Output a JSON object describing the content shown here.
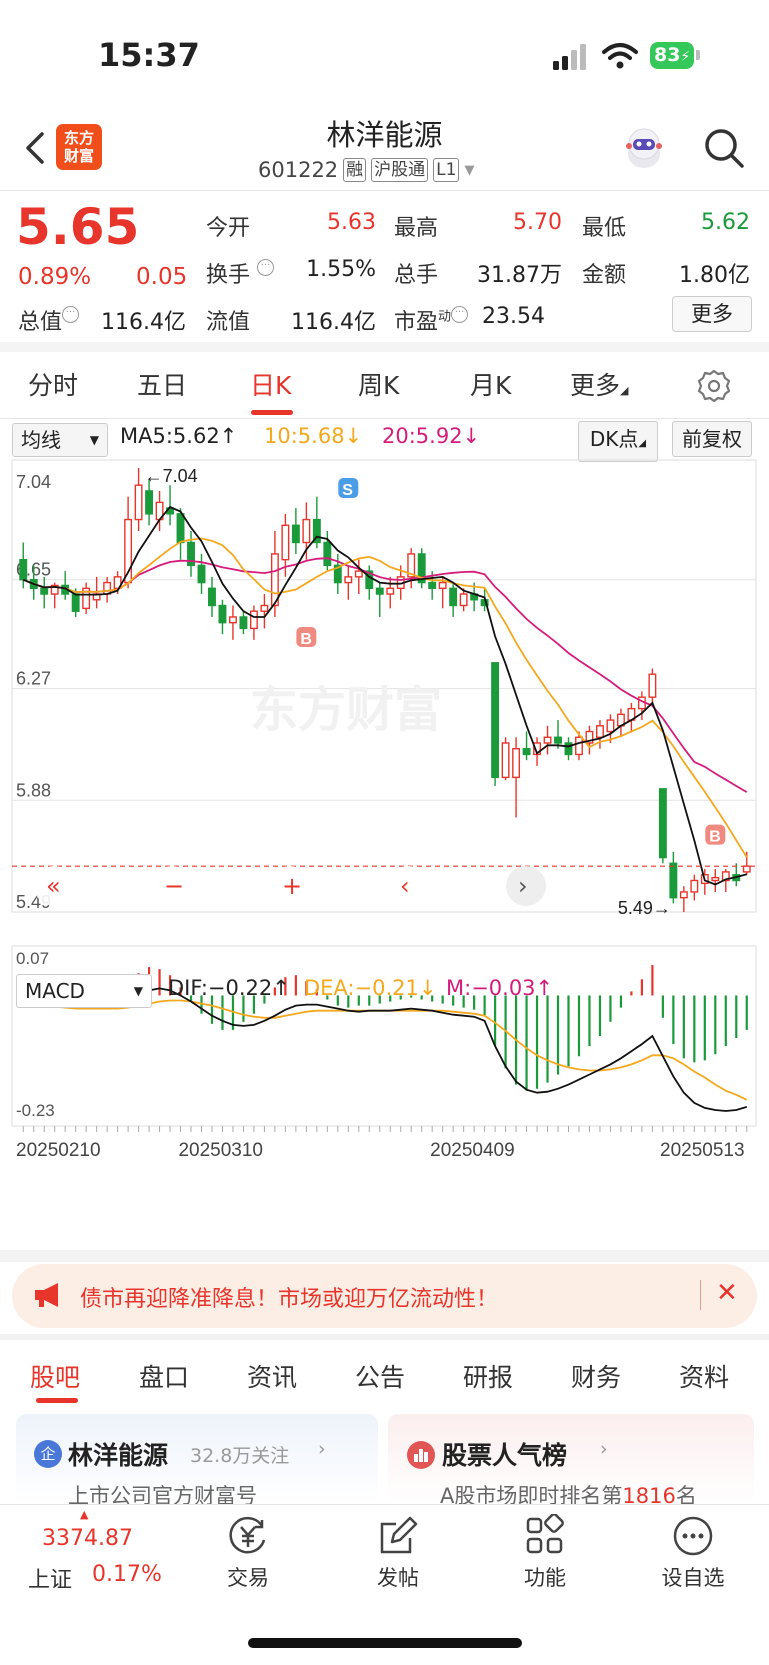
{
  "status": {
    "time": "15:37",
    "battery": "83"
  },
  "header": {
    "logo_line1": "东方",
    "logo_line2": "财富",
    "title": "林洋能源",
    "code": "601222",
    "tag_margin": "融",
    "tag_connect": "沪股通",
    "tag_level": "L1"
  },
  "quote": {
    "price": "5.65",
    "change_pct": "0.89%",
    "change": "0.05",
    "open_label": "今开",
    "open": "5.63",
    "high_label": "最高",
    "high": "5.70",
    "low_label": "最低",
    "low": "5.62",
    "turnover_label": "换手",
    "turnover": "1.55%",
    "volume_label": "总手",
    "volume": "31.87万",
    "amount_label": "金额",
    "amount": "1.80亿",
    "mktcap_label": "总值",
    "mktcap": "116.4亿",
    "float_label": "流值",
    "float_cap": "116.4亿",
    "pe_label": "市盈",
    "pe_sup": "动",
    "pe": "23.54",
    "more_button": "更多"
  },
  "period_tabs": [
    "分时",
    "五日",
    "日K",
    "周K",
    "月K",
    "更多"
  ],
  "ma_row": {
    "indicator_select": "均线",
    "ma5": "MA5:5.62↑",
    "ma10": "10:5.68↓",
    "ma20": "20:5.92↓",
    "dk_button": "DK点",
    "adjust_button": "前复权"
  },
  "macd_row": {
    "indicator_select": "MACD",
    "dif": "DIF:−0.22↑",
    "dea": "DEA:−0.21↓",
    "m": "M:−0.03↑"
  },
  "colors": {
    "up": "#e8352b",
    "down": "#1a9a3a",
    "ma5": "#111111",
    "ma10": "#f4a81d",
    "ma20": "#d61c7b"
  },
  "chart_data": {
    "type": "candlestick",
    "price_axis_ticks": [
      "7.04",
      "6.65",
      "6.27",
      "5.88",
      "5.49"
    ],
    "ylim": [
      5.49,
      7.04
    ],
    "macd_axis_ticks": [
      "0.07",
      "-0.23"
    ],
    "macd_ylim": [
      -0.23,
      0.07
    ],
    "date_labels": [
      "20250210",
      "20250310",
      "20250409",
      "20250513"
    ],
    "annotations": {
      "max_label": "←7.04",
      "min_label": "5.49→",
      "watermark": "东方财富",
      "signal_S": "S",
      "signal_B": "B"
    },
    "candles": [
      [
        6.72,
        6.78,
        6.62,
        6.65
      ],
      [
        6.65,
        6.7,
        6.58,
        6.62
      ],
      [
        6.62,
        6.66,
        6.55,
        6.6
      ],
      [
        6.6,
        6.64,
        6.55,
        6.63
      ],
      [
        6.63,
        6.68,
        6.58,
        6.6
      ],
      [
        6.6,
        6.62,
        6.52,
        6.54
      ],
      [
        6.55,
        6.64,
        6.53,
        6.62
      ],
      [
        6.58,
        6.66,
        6.55,
        6.6
      ],
      [
        6.6,
        6.66,
        6.57,
        6.64
      ],
      [
        6.62,
        6.68,
        6.6,
        6.66
      ],
      [
        6.64,
        6.94,
        6.62,
        6.86
      ],
      [
        6.86,
        7.04,
        6.82,
        6.98
      ],
      [
        6.96,
        7.0,
        6.84,
        6.88
      ],
      [
        6.86,
        6.96,
        6.82,
        6.92
      ],
      [
        6.9,
        6.98,
        6.84,
        6.88
      ],
      [
        6.88,
        6.9,
        6.72,
        6.78
      ],
      [
        6.78,
        6.82,
        6.66,
        6.7
      ],
      [
        6.7,
        6.74,
        6.6,
        6.64
      ],
      [
        6.62,
        6.66,
        6.52,
        6.56
      ],
      [
        6.56,
        6.58,
        6.46,
        6.5
      ],
      [
        6.5,
        6.56,
        6.44,
        6.52
      ],
      [
        6.52,
        6.54,
        6.46,
        6.48
      ],
      [
        6.48,
        6.56,
        6.44,
        6.54
      ],
      [
        6.54,
        6.6,
        6.48,
        6.56
      ],
      [
        6.56,
        6.82,
        6.52,
        6.74
      ],
      [
        6.72,
        6.88,
        6.66,
        6.84
      ],
      [
        6.84,
        6.9,
        6.74,
        6.78
      ],
      [
        6.78,
        6.92,
        6.72,
        6.86
      ],
      [
        6.86,
        6.94,
        6.76,
        6.78
      ],
      [
        6.78,
        6.82,
        6.68,
        6.7
      ],
      [
        6.7,
        6.74,
        6.6,
        6.64
      ],
      [
        6.64,
        6.7,
        6.58,
        6.66
      ],
      [
        6.66,
        6.72,
        6.6,
        6.68
      ],
      [
        6.68,
        6.7,
        6.58,
        6.62
      ],
      [
        6.62,
        6.64,
        6.52,
        6.6
      ],
      [
        6.6,
        6.66,
        6.55,
        6.62
      ],
      [
        6.62,
        6.7,
        6.58,
        6.66
      ],
      [
        6.66,
        6.76,
        6.62,
        6.74
      ],
      [
        6.74,
        6.76,
        6.62,
        6.64
      ],
      [
        6.64,
        6.68,
        6.58,
        6.62
      ],
      [
        6.62,
        6.66,
        6.55,
        6.64
      ],
      [
        6.62,
        6.64,
        6.52,
        6.56
      ],
      [
        6.56,
        6.62,
        6.54,
        6.6
      ],
      [
        6.6,
        6.64,
        6.54,
        6.58
      ],
      [
        6.58,
        6.62,
        6.54,
        6.56
      ],
      [
        6.36,
        6.36,
        5.93,
        5.96
      ],
      [
        5.96,
        6.1,
        5.95,
        6.08
      ],
      [
        5.96,
        6.1,
        5.82,
        6.06
      ],
      [
        6.06,
        6.12,
        6.02,
        6.04
      ],
      [
        6.04,
        6.1,
        6.0,
        6.08
      ],
      [
        6.08,
        6.14,
        6.04,
        6.1
      ],
      [
        6.1,
        6.16,
        6.06,
        6.08
      ],
      [
        6.08,
        6.1,
        6.02,
        6.04
      ],
      [
        6.04,
        6.12,
        6.02,
        6.1
      ],
      [
        6.08,
        6.14,
        6.04,
        6.12
      ],
      [
        6.1,
        6.16,
        6.06,
        6.14
      ],
      [
        6.12,
        6.18,
        6.08,
        6.16
      ],
      [
        6.14,
        6.2,
        6.1,
        6.18
      ],
      [
        6.16,
        6.22,
        6.12,
        6.2
      ],
      [
        6.2,
        6.26,
        6.16,
        6.24
      ],
      [
        6.24,
        6.34,
        6.22,
        6.32
      ],
      [
        5.92,
        5.92,
        5.66,
        5.68
      ],
      [
        5.66,
        5.7,
        5.52,
        5.54
      ],
      [
        5.54,
        5.58,
        5.49,
        5.56
      ],
      [
        5.56,
        5.62,
        5.53,
        5.6
      ],
      [
        5.59,
        5.64,
        5.55,
        5.62
      ],
      [
        5.6,
        5.64,
        5.56,
        5.61
      ],
      [
        5.6,
        5.64,
        5.56,
        5.63
      ],
      [
        5.62,
        5.66,
        5.58,
        5.6
      ],
      [
        5.63,
        5.7,
        5.62,
        5.65
      ]
    ],
    "macd_hist": [
      0.018,
      0.012,
      0.008,
      0.004,
      -0.004,
      -0.01,
      -0.006,
      -0.002,
      0.002,
      0.006,
      0.014,
      0.022,
      0.028,
      0.026,
      0.02,
      0.008,
      -0.006,
      -0.018,
      -0.028,
      -0.034,
      -0.034,
      -0.026,
      -0.018,
      -0.008,
      0.008,
      0.018,
      0.02,
      0.014,
      0.006,
      -0.004,
      -0.01,
      -0.012,
      -0.01,
      -0.01,
      -0.008,
      -0.006,
      -0.004,
      -0.002,
      -0.004,
      -0.006,
      -0.008,
      -0.01,
      -0.012,
      -0.014,
      -0.02,
      -0.05,
      -0.072,
      -0.088,
      -0.094,
      -0.092,
      -0.086,
      -0.078,
      -0.07,
      -0.06,
      -0.05,
      -0.04,
      -0.026,
      -0.012,
      0.004,
      0.016,
      0.03,
      -0.022,
      -0.048,
      -0.062,
      -0.066,
      -0.064,
      -0.058,
      -0.05,
      -0.042,
      -0.034
    ],
    "dif_line": [
      0.0,
      -0.002,
      -0.006,
      -0.01,
      -0.016,
      -0.02,
      -0.022,
      -0.022,
      -0.022,
      -0.02,
      -0.01,
      0.002,
      0.01,
      0.014,
      0.01,
      0.0,
      -0.012,
      -0.026,
      -0.04,
      -0.05,
      -0.058,
      -0.06,
      -0.058,
      -0.05,
      -0.04,
      -0.028,
      -0.02,
      -0.018,
      -0.018,
      -0.022,
      -0.026,
      -0.03,
      -0.032,
      -0.03,
      -0.03,
      -0.03,
      -0.028,
      -0.026,
      -0.028,
      -0.03,
      -0.034,
      -0.038,
      -0.04,
      -0.042,
      -0.05,
      -0.1,
      -0.14,
      -0.17,
      -0.186,
      -0.192,
      -0.19,
      -0.184,
      -0.176,
      -0.166,
      -0.156,
      -0.146,
      -0.136,
      -0.124,
      -0.11,
      -0.096,
      -0.08,
      -0.12,
      -0.16,
      -0.192,
      -0.212,
      -0.222,
      -0.226,
      -0.228,
      -0.226,
      -0.22
    ],
    "dea_line": [
      -0.018,
      -0.018,
      -0.02,
      -0.022,
      -0.024,
      -0.026,
      -0.026,
      -0.026,
      -0.026,
      -0.026,
      -0.024,
      -0.02,
      -0.016,
      -0.012,
      -0.01,
      -0.01,
      -0.012,
      -0.016,
      -0.02,
      -0.026,
      -0.032,
      -0.038,
      -0.042,
      -0.044,
      -0.044,
      -0.04,
      -0.036,
      -0.032,
      -0.03,
      -0.03,
      -0.03,
      -0.03,
      -0.03,
      -0.03,
      -0.03,
      -0.03,
      -0.03,
      -0.03,
      -0.03,
      -0.03,
      -0.03,
      -0.032,
      -0.034,
      -0.036,
      -0.04,
      -0.054,
      -0.07,
      -0.088,
      -0.104,
      -0.118,
      -0.128,
      -0.136,
      -0.142,
      -0.146,
      -0.148,
      -0.148,
      -0.146,
      -0.142,
      -0.136,
      -0.128,
      -0.118,
      -0.118,
      -0.124,
      -0.136,
      -0.15,
      -0.162,
      -0.176,
      -0.188,
      -0.196,
      -0.206
    ]
  },
  "banner": {
    "text": "债市再迎降准降息！市场或迎万亿流动性！",
    "close": "✕"
  },
  "bottom_tabs": [
    "股吧",
    "盘口",
    "资讯",
    "公告",
    "研报",
    "财务",
    "资料"
  ],
  "cards": {
    "left_badge": "企",
    "left_title": "林洋能源",
    "left_follow": "32.8万关注",
    "left_sub": "上市公司官方财富号",
    "right_title": "股票人气榜",
    "right_sub_prefix": "A股市场即时排名第",
    "right_rank": "1816",
    "right_sub_suffix": "名"
  },
  "bottom_bar": {
    "index_value": "3374.87",
    "index_name": "上证",
    "index_change": "0.17%",
    "nav": [
      "交易",
      "发帖",
      "功能",
      "设自选"
    ]
  }
}
